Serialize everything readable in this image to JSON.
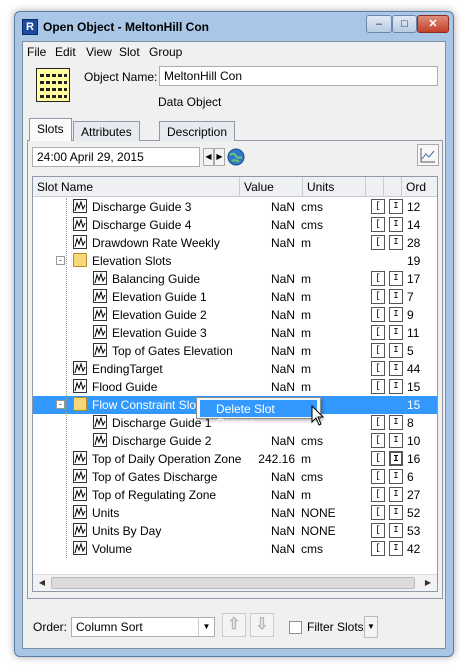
{
  "window": {
    "title": "Open Object - MeltonHill Con",
    "app_icon": "riverware-icon"
  },
  "menu": [
    "File",
    "Edit",
    "View",
    "Slot",
    "Group"
  ],
  "object": {
    "name_label": "Object Name:",
    "name_value": "MeltonHill Con",
    "type": "Data Object",
    "icon": "data-object-icon"
  },
  "tabs": [
    "Slots",
    "Attributes",
    "Description"
  ],
  "date": {
    "value": "24:00 April 29, 2015"
  },
  "table": {
    "columns": [
      "Slot Name",
      "Value",
      "Units",
      "Ord"
    ],
    "rows": [
      {
        "name": "Discharge Guide 3",
        "value": "NaN",
        "units": "cms",
        "flags": [
          "[",
          "I"
        ],
        "ord": "12",
        "level": 1,
        "type": "slot"
      },
      {
        "name": "Discharge Guide 4",
        "value": "NaN",
        "units": "cms",
        "flags": [
          "[",
          "I"
        ],
        "ord": "14",
        "level": 1,
        "type": "slot"
      },
      {
        "name": "Drawdown Rate Weekly",
        "value": "NaN",
        "units": "m",
        "flags": [
          "[",
          "I"
        ],
        "ord": "28",
        "level": 1,
        "type": "slot"
      },
      {
        "name": "Elevation Slots",
        "value": "",
        "units": "",
        "flags": [],
        "ord": "19",
        "level": 1,
        "type": "group",
        "expanded": true
      },
      {
        "name": "Balancing Guide",
        "value": "NaN",
        "units": "m",
        "flags": [
          "[",
          "I"
        ],
        "ord": "17",
        "level": 2,
        "type": "slot"
      },
      {
        "name": "Elevation Guide 1",
        "value": "NaN",
        "units": "m",
        "flags": [
          "[",
          "I"
        ],
        "ord": "7",
        "level": 2,
        "type": "slot"
      },
      {
        "name": "Elevation Guide 2",
        "value": "NaN",
        "units": "m",
        "flags": [
          "[",
          "I"
        ],
        "ord": "9",
        "level": 2,
        "type": "slot"
      },
      {
        "name": "Elevation Guide 3",
        "value": "NaN",
        "units": "m",
        "flags": [
          "[",
          "I"
        ],
        "ord": "11",
        "level": 2,
        "type": "slot"
      },
      {
        "name": "Top of Gates Elevation",
        "value": "NaN",
        "units": "m",
        "flags": [
          "[",
          "I"
        ],
        "ord": "5",
        "level": 2,
        "type": "slot"
      },
      {
        "name": "EndingTarget",
        "value": "NaN",
        "units": "m",
        "flags": [
          "[",
          "I"
        ],
        "ord": "44",
        "level": 1,
        "type": "slot"
      },
      {
        "name": "Flood Guide",
        "value": "NaN",
        "units": "m",
        "flags": [
          "[",
          "I"
        ],
        "ord": "15",
        "level": 1,
        "type": "slot"
      },
      {
        "name": "Flow Constraint Slots",
        "value": "",
        "units": "",
        "flags": [],
        "ord": "15",
        "level": 1,
        "type": "group",
        "expanded": true,
        "selected": true
      },
      {
        "name": "Discharge Guide 1",
        "value": "",
        "units": "",
        "flags": [
          "[",
          "I"
        ],
        "ord": "8",
        "level": 2,
        "type": "slot"
      },
      {
        "name": "Discharge Guide 2",
        "value": "NaN",
        "units": "cms",
        "flags": [
          "[",
          "I"
        ],
        "ord": "10",
        "level": 2,
        "type": "slot"
      },
      {
        "name": "Top of Daily Operation Zone",
        "value": "242.16",
        "units": "m",
        "flags": [
          "[",
          "I"
        ],
        "ord": "16",
        "level": 1,
        "type": "slot",
        "dark_flag": true
      },
      {
        "name": "Top of Gates Discharge",
        "value": "NaN",
        "units": "cms",
        "flags": [
          "[",
          "I"
        ],
        "ord": "6",
        "level": 1,
        "type": "slot"
      },
      {
        "name": "Top of Regulating Zone",
        "value": "NaN",
        "units": "m",
        "flags": [
          "[",
          "I"
        ],
        "ord": "27",
        "level": 1,
        "type": "slot"
      },
      {
        "name": "Units",
        "value": "NaN",
        "units": "NONE",
        "flags": [
          "[",
          "I"
        ],
        "ord": "52",
        "level": 1,
        "type": "slot"
      },
      {
        "name": "Units By Day",
        "value": "NaN",
        "units": "NONE",
        "flags": [
          "[",
          "I"
        ],
        "ord": "53",
        "level": 1,
        "type": "slot"
      },
      {
        "name": "Volume",
        "value": "NaN",
        "units": "cms",
        "flags": [
          "[",
          "I"
        ],
        "ord": "42",
        "level": 1,
        "type": "slot"
      }
    ]
  },
  "context_menu": {
    "item": "Delete Slot Groups"
  },
  "bottom": {
    "order_label": "Order:",
    "order_value": "Column Sort",
    "filter_label": "Filter Slots"
  },
  "colors": {
    "selection": "#3399ff",
    "window_frame": "#a9c6e6",
    "folder": "#f6d77a"
  }
}
